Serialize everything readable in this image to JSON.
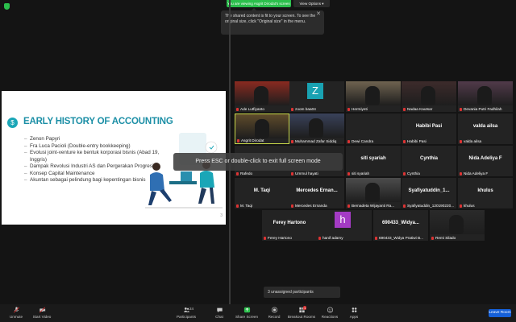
{
  "banner": {
    "sharing_text": "You are viewing Asgrit Dirodat's screen",
    "view_options": "View Options ▾"
  },
  "tooltip": {
    "text": "The shared content is fit to your screen. To see the original size, click \"Original size\" in the menu.",
    "close": "✕"
  },
  "slide": {
    "title": "EARLY HISTORY OF ACCOUNTING",
    "bullets": [
      "Zenon Papyri",
      "Fra Luca Pacioli (Double-entry bookkeeping)",
      "Evolusi joint-venture ke bentuk korporasi bisnis (Abad 19, Inggris)",
      "Dampak Revolusi Industri AS dan Pergerakan Progresif",
      "Konsep Capital Maintenance",
      "Akuntan sebagai pelindung bagi kepentingan bisnis"
    ],
    "page_number": "3"
  },
  "esc_message": "Press ESC or double-click to exit full screen mode",
  "participants": [
    {
      "name": "Ade Lutfiyanto",
      "kind": "video",
      "color": "#8a2a20"
    },
    {
      "name": "zoom baa04",
      "kind": "avatar-z",
      "letter": "Z"
    },
    {
      "name": "Hermiyeti",
      "kind": "video",
      "color": "#6f6350"
    },
    {
      "name": "Nadaa Kautsar",
      "kind": "video",
      "color": "#3d2b2b"
    },
    {
      "name": "Devania Putri Fadhilah",
      "kind": "video",
      "color": "#513a4a"
    },
    {
      "name": "Asgrit Dirodat",
      "kind": "video",
      "color": "#5e4b2b"
    },
    {
      "name": "Muhammad Zafar Siddiq",
      "kind": "video",
      "color": "#39425a"
    },
    {
      "name": "Dewi Candra",
      "kind": "name",
      "title": ""
    },
    {
      "name": "Habibi Pasi",
      "kind": "name",
      "title": "Habibi Pasi"
    },
    {
      "name": "valda ailsa",
      "kind": "name",
      "title": "valda ailsa"
    },
    {
      "name": "Rafedo",
      "kind": "name",
      "title": ""
    },
    {
      "name": "Ummul hayati",
      "kind": "name",
      "title": ""
    },
    {
      "name": "siti syariah",
      "kind": "name",
      "title": "siti syariah"
    },
    {
      "name": "Cynthia",
      "kind": "name",
      "title": "Cynthia"
    },
    {
      "name": "Nida Adeliya F",
      "kind": "name",
      "title": "Nida Adeliya F"
    },
    {
      "name": "M. Taqi",
      "kind": "name",
      "title": "M. Taqi"
    },
    {
      "name": "Mercedes Ernanda",
      "kind": "name",
      "title": "Mercedes Ernan..."
    },
    {
      "name": "Bernadeta Wijayanti Ra...",
      "kind": "video",
      "color": "#4c4c4c"
    },
    {
      "name": "Syafiyatuddin_120190220...",
      "kind": "name",
      "title": "Syafiyatuddin_1..."
    },
    {
      "name": "khulus",
      "kind": "name",
      "title": "khulus"
    },
    {
      "name": "Ferey Hartono",
      "kind": "name",
      "title": "Ferey Hartono"
    },
    {
      "name": "hanif adamy",
      "kind": "avatar-h",
      "letter": "h"
    },
    {
      "name": "690433_Widya Pratiwi B...",
      "kind": "name",
      "title": "690433_Widya..."
    },
    {
      "name": "Remi Silado",
      "kind": "video",
      "color": "#2a2a2a"
    }
  ],
  "unassigned": "3 unassigned participants",
  "toolbar": {
    "unmute": "Unmute",
    "start_video": "Start Video",
    "participants": "Participants",
    "participants_count": "24",
    "chat": "Chat",
    "share_screen": "Share Screen",
    "record": "Record",
    "breakout_rooms": "Breakout Rooms",
    "breakout_badge": "1",
    "reactions": "Reactions",
    "apps": "Apps",
    "leave": "Leave Room"
  },
  "colors": {
    "share_green": "#2bbf4c",
    "slide_title": "#1c8fa6",
    "leave_blue": "#1560d9",
    "muted_red": "#dd3333"
  }
}
